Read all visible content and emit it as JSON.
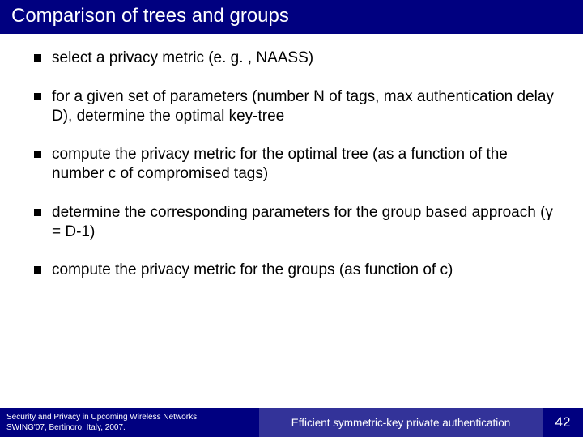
{
  "title": "Comparison of trees and groups",
  "bullets": [
    "select a privacy metric (e. g. , NAASS)",
    "for a given set of parameters (number N of tags, max authentication delay D), determine the optimal key-tree",
    "compute the privacy metric for the optimal tree (as a function of the number c of compromised tags)",
    "determine the corresponding parameters for the group based approach (γ = D-1)",
    "compute the privacy metric for the groups (as function of c)"
  ],
  "footer": {
    "left_line1": "Security and Privacy in Upcoming Wireless Networks",
    "left_line2": "SWING'07, Bertinoro, Italy, 2007.",
    "mid": "Efficient symmetric-key private authentication",
    "page": "42"
  }
}
